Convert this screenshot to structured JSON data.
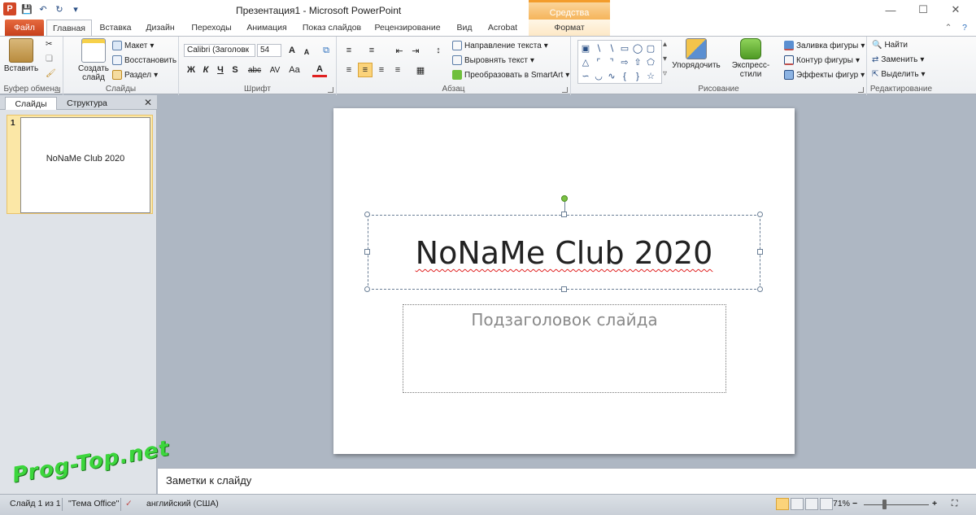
{
  "window": {
    "title": "Презентация1 - Microsoft PowerPoint",
    "context_tab_title": "Средства рисования",
    "app_icon": "P"
  },
  "tabs": [
    "Файл",
    "Главная",
    "Вставка",
    "Дизайн",
    "Переходы",
    "Анимация",
    "Показ слайдов",
    "Рецензирование",
    "Вид",
    "Acrobat",
    "Формат"
  ],
  "ribbon": {
    "clipboard": {
      "label": "Буфер обмена",
      "paste": "Вставить"
    },
    "slides": {
      "label": "Слайды",
      "new_slide_1": "Создать",
      "new_slide_2": "слайд",
      "layout": "Макет",
      "reset": "Восстановить",
      "section": "Раздел"
    },
    "font": {
      "label": "Шрифт",
      "font_name": "Calibri (Заголовк",
      "font_size": "54",
      "bold": "Ж",
      "italic": "К",
      "underline": "Ч",
      "strike": "S",
      "shadow": "abc",
      "spacing": "AV",
      "case": "Aa",
      "color": "A",
      "grow": "A",
      "shrink": "A"
    },
    "paragraph": {
      "label": "Абзац",
      "text_direction": "Направление текста",
      "align_text": "Выровнять текст",
      "smartart": "Преобразовать в SmartArt"
    },
    "drawing": {
      "label": "Рисование",
      "arrange": "Упорядочить",
      "quick_styles": "Экспресс-стили",
      "shape_fill": "Заливка фигуры",
      "shape_outline": "Контур фигуры",
      "shape_effects": "Эффекты фигур"
    },
    "editing": {
      "label": "Редактирование",
      "find": "Найти",
      "replace": "Заменить",
      "select": "Выделить"
    }
  },
  "panel": {
    "tab_slides": "Слайды",
    "tab_outline": "Структура",
    "thumb_number": "1",
    "thumb_title": "NoNaMe Club 2020"
  },
  "slide": {
    "title": "NoNaMe Club 2020",
    "subtitle_placeholder": "Подзаголовок слайда"
  },
  "notes": {
    "placeholder": "Заметки к слайду"
  },
  "watermark": "Prog-Top.net",
  "status": {
    "slide_counter": "Слайд 1 из 1",
    "theme": "\"Тема Office\"",
    "language": "английский (США)",
    "zoom": "71%"
  },
  "colors": {
    "accent": "#d24726",
    "context_tab": "#f5b45a",
    "selection": "#fbe7a6"
  }
}
